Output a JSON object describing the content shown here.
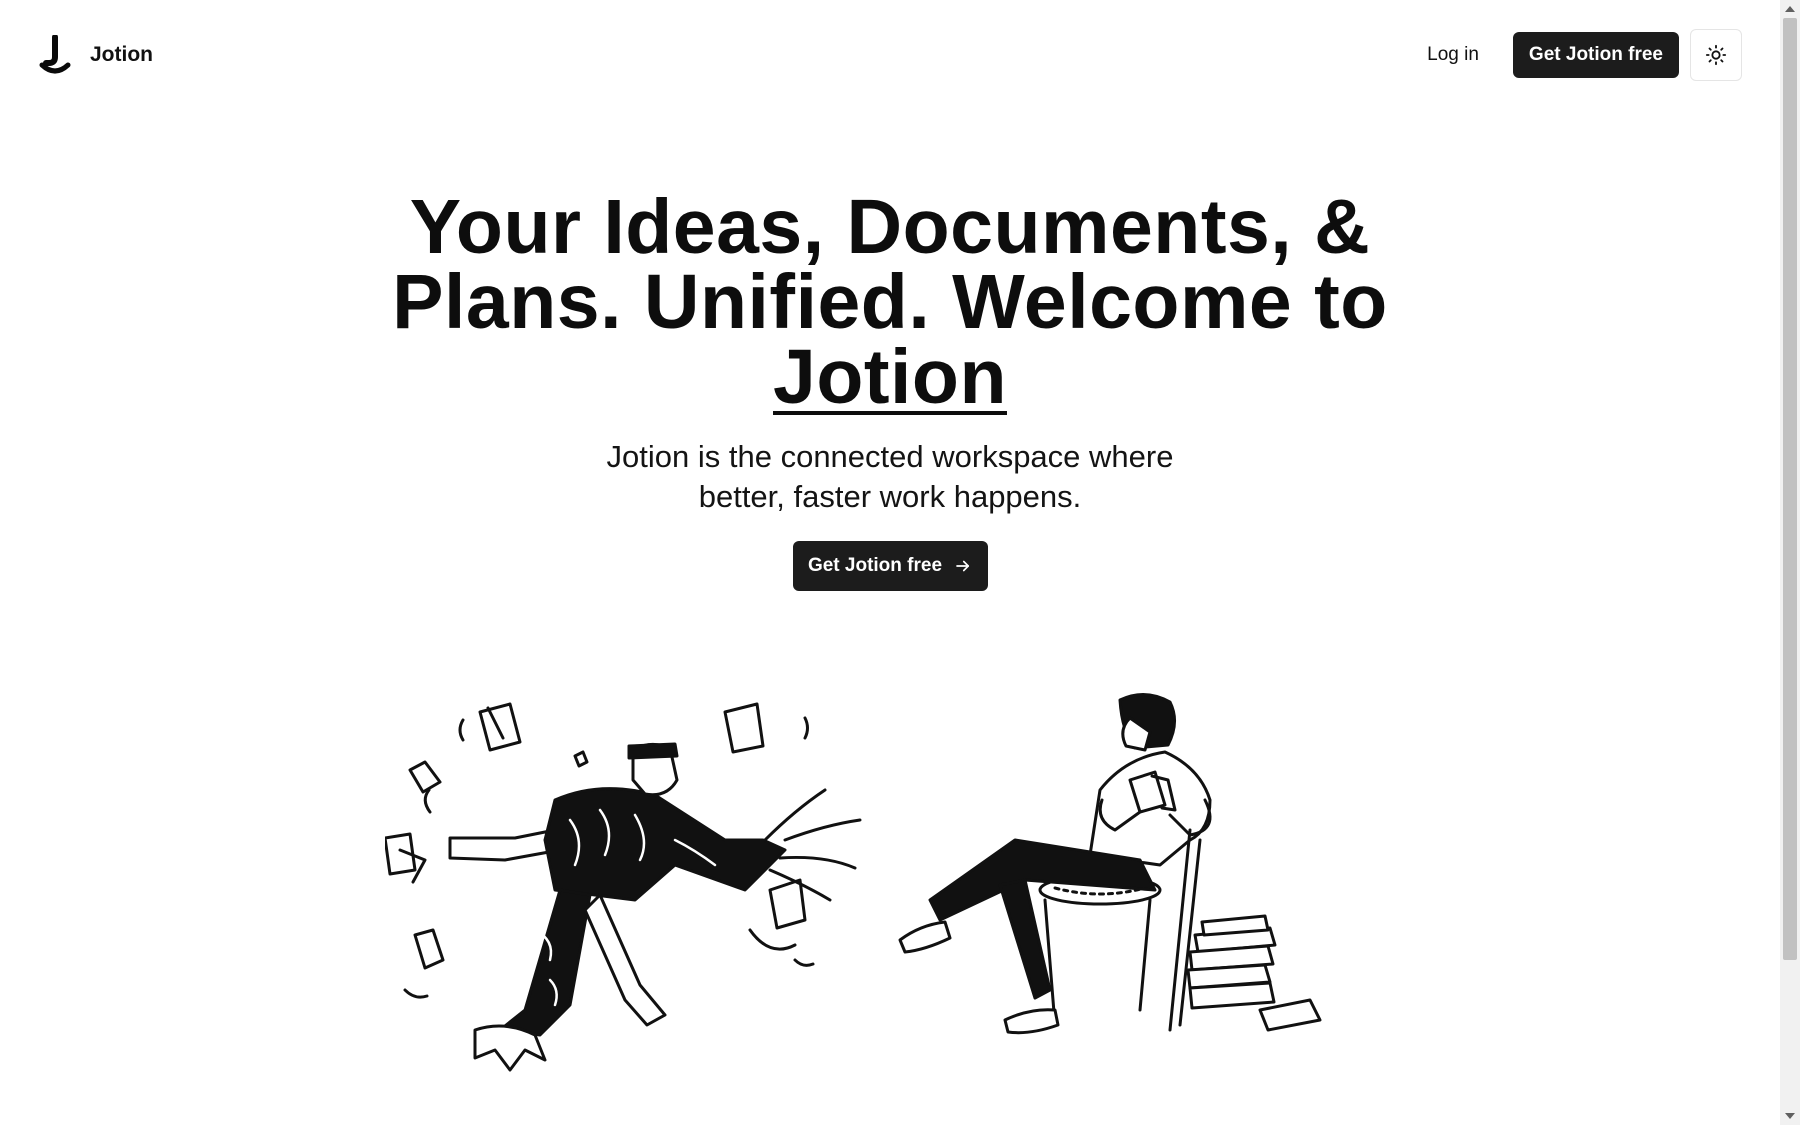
{
  "nav": {
    "brand": "Jotion",
    "login": "Log in",
    "cta": "Get Jotion free",
    "theme_icon": "sun-icon"
  },
  "hero": {
    "heading_main": "Your Ideas, Documents, & Plans. Unified. Welcome to",
    "heading_brand": "Jotion",
    "subheading": "Jotion is the connected workspace where better, faster work happens.",
    "cta": "Get Jotion free",
    "cta_icon": "arrow-right-icon"
  },
  "illustrations": [
    "person-juggling-papers-illustration",
    "person-reading-in-chair-illustration"
  ],
  "colors": {
    "primary": "#1c1c1c",
    "background": "#ffffff",
    "text": "#0a0a0a"
  }
}
